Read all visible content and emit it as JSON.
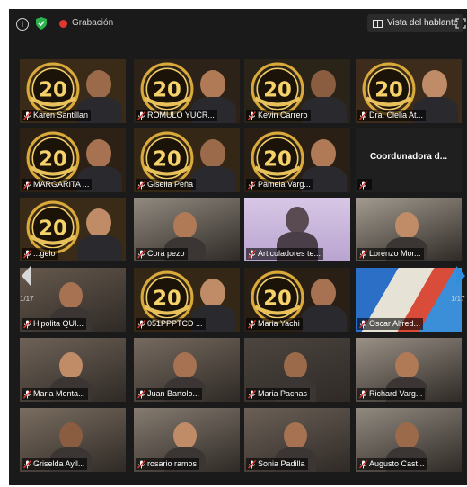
{
  "topbar": {
    "recording_label": "Grabación",
    "view_button_label": "Vista del hablante"
  },
  "pager": {
    "left": "1/17",
    "right": "1/17"
  },
  "colors": {
    "active_border": "#c8dc6a",
    "recording": "#e2362f",
    "nav_arrow": "#2f8fdd",
    "muted_mic": "#e2362f"
  },
  "tiles": [
    {
      "name": "Karen Santillan",
      "kind": "emblem"
    },
    {
      "name": "ROMULO YUCR...",
      "kind": "emblem"
    },
    {
      "name": "Kevin Carrero",
      "kind": "emblem"
    },
    {
      "name": "Dra. Clelia At...",
      "kind": "emblem"
    },
    {
      "name": "MARGARITA ...",
      "kind": "emblem"
    },
    {
      "name": "Gisella Peña",
      "kind": "emblem"
    },
    {
      "name": "Pamela Varg...",
      "kind": "emblem"
    },
    {
      "name": "Coordunadora d...",
      "kind": "text"
    },
    {
      "name": "...gelo",
      "kind": "emblem"
    },
    {
      "name": "Cora pezo",
      "kind": "room"
    },
    {
      "name": "Articuladores te...",
      "kind": "active"
    },
    {
      "name": "Lorenzo Mor...",
      "kind": "room"
    },
    {
      "name": "Hipolita QUI...",
      "kind": "room"
    },
    {
      "name": "051PPPTCD ...",
      "kind": "emblem"
    },
    {
      "name": "Maria Yachi",
      "kind": "emblem"
    },
    {
      "name": "Oscar Alfred...",
      "kind": "poster"
    },
    {
      "name": "Maria Monta...",
      "kind": "room"
    },
    {
      "name": "Juan Bartolo...",
      "kind": "room"
    },
    {
      "name": "Maria Pachas",
      "kind": "room"
    },
    {
      "name": "Richard Varg...",
      "kind": "room"
    },
    {
      "name": "Griselda Ayll...",
      "kind": "room"
    },
    {
      "name": "rosario ramos",
      "kind": "room"
    },
    {
      "name": "Sonia Padilla",
      "kind": "room"
    },
    {
      "name": "Augusto Cast...",
      "kind": "room"
    }
  ]
}
